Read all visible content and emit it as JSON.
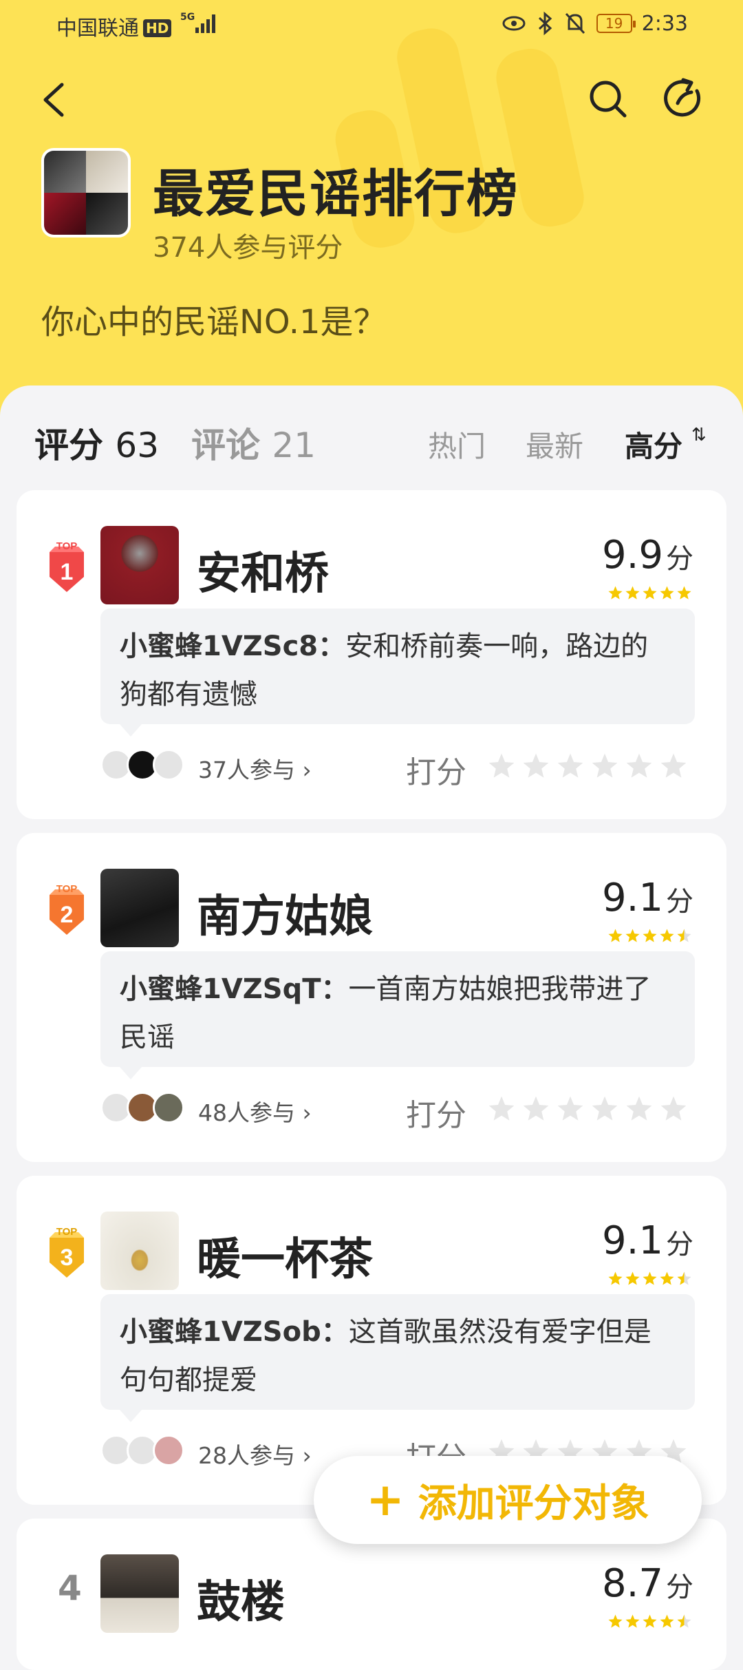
{
  "status_bar": {
    "carrier": "中国联通",
    "hd": "HD",
    "network": "5G",
    "battery": "19",
    "time": "2:33"
  },
  "header": {
    "title": "最爱民谣排行榜",
    "participants": "374人参与评分",
    "question": "你心中的民谣NO.1是？"
  },
  "tabs": {
    "rating_label": "评分",
    "rating_count": "63",
    "comment_label": "评论",
    "comment_count": "21",
    "sort_hot": "热门",
    "sort_new": "最新",
    "sort_high": "高分"
  },
  "items": [
    {
      "rank": "1",
      "title": "安和桥",
      "score": "9.9",
      "unit": "分",
      "stars": 5,
      "commenter": "小蜜蜂1VZSc8：",
      "comment": "安和桥前奏一响，路边的狗都有遗憾",
      "joined": "37人参与",
      "rate_label": "打分",
      "badge_color": "#f04848"
    },
    {
      "rank": "2",
      "title": "南方姑娘",
      "score": "9.1",
      "unit": "分",
      "stars": 4.5,
      "commenter": "小蜜蜂1VZSqT：",
      "comment": "一首南方姑娘把我带进了民谣",
      "joined": "48人参与",
      "rate_label": "打分",
      "badge_color": "#f5762f"
    },
    {
      "rank": "3",
      "title": "暖一杯茶",
      "score": "9.1",
      "unit": "分",
      "stars": 4.5,
      "commenter": "小蜜蜂1VZSob：",
      "comment": "这首歌虽然没有爱字但是句句都提爱",
      "joined": "28人参与",
      "rate_label": "打分",
      "badge_color": "#f3b21c"
    },
    {
      "rank": "4",
      "title": "鼓楼",
      "score": "8.7",
      "unit": "分",
      "stars": 4.5
    }
  ],
  "badge_text": "TOP",
  "fab": {
    "label": "添加评分对象"
  },
  "colors": {
    "accent": "#fde255",
    "star": "#f6c800",
    "fab_text": "#f2b705"
  }
}
